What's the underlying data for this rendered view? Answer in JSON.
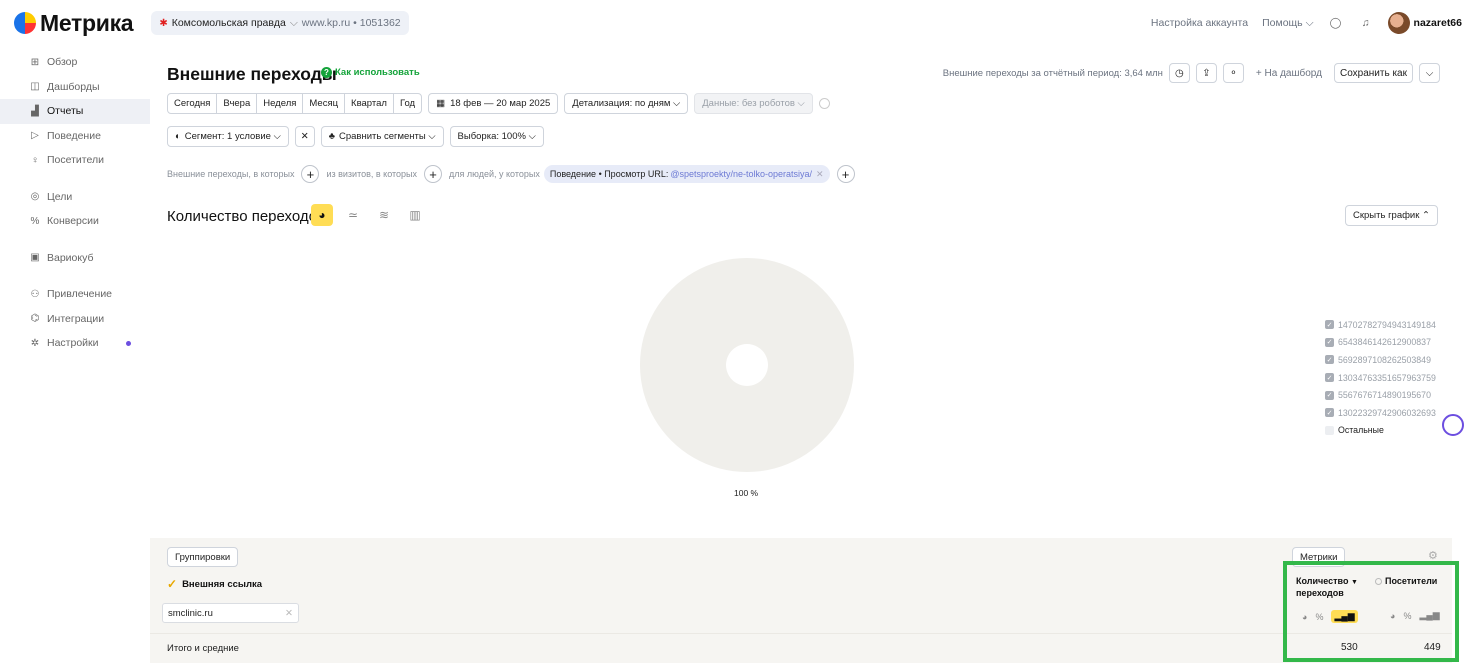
{
  "app": {
    "logo_text": "Метрика",
    "counter_name": "Комсомольская правда",
    "counter_site": "www.kp.ru",
    "counter_id": "1051362"
  },
  "topbar": {
    "account_settings": "Настройка аккаунта",
    "help": "Помощь",
    "user_name": "nazaret66"
  },
  "sidebar": {
    "items": [
      {
        "label": "Обзор",
        "icon": "grid-icon"
      },
      {
        "label": "Дашборды",
        "icon": "dashboard-icon"
      },
      {
        "label": "Отчеты",
        "icon": "reports-icon",
        "active": true
      },
      {
        "label": "Поведение",
        "icon": "play-icon"
      },
      {
        "label": "Посетители",
        "icon": "person-icon"
      },
      {
        "label": "Цели",
        "icon": "target-icon"
      },
      {
        "label": "Конверсии",
        "icon": "percent-icon"
      },
      {
        "label": "Вариокуб",
        "icon": "cube-icon"
      },
      {
        "label": "Привлечение",
        "icon": "users-icon"
      },
      {
        "label": "Интеграции",
        "icon": "integrations-icon"
      },
      {
        "label": "Настройки",
        "icon": "gear-icon"
      }
    ]
  },
  "header": {
    "title": "Внешние переходы",
    "how_to": "Как использовать",
    "period_total": "Внешние переходы за отчётный период: 3,64 млн",
    "to_dashboard": "+ На дашборд",
    "save_as": "Сохранить как"
  },
  "period": {
    "options": [
      "Сегодня",
      "Вчера",
      "Неделя",
      "Месяц",
      "Квартал",
      "Год"
    ],
    "date_range": "18 фев — 20 мар 2025",
    "detail": "Детализация: по дням",
    "data": "Данные: без роботов"
  },
  "segment": {
    "label": "Сегмент: 1 условие",
    "compare": "Сравнить сегменты",
    "sample": "Выборка: 100%"
  },
  "filters": {
    "text1": "Внешние переходы, в которых",
    "text2": "из визитов, в которых",
    "text3": "для людей, у которых",
    "condition_label": "Поведение • Просмотр URL:",
    "condition_value": "@spetsproekty/ne-tolko-operatsiya/"
  },
  "chart": {
    "title": "Количество переходов",
    "hide_button": "Скрыть график",
    "center_label": "100 %",
    "legend": [
      "14702782794943149184",
      "6543846142612900837",
      "5692897108262503849",
      "13034763351657963759",
      "5567676714890195670",
      "13022329742906032693",
      "Остальные"
    ],
    "donut_color": "#f0efeb"
  },
  "chart_data": {
    "type": "pie",
    "categories": [
      "smclinic.ru"
    ],
    "values": [
      100
    ],
    "title": "Количество переходов"
  },
  "table": {
    "groupings_btn": "Группировки",
    "metrics_btn": "Метрики",
    "dimension": "Внешняя ссылка",
    "filter_value": "smclinic.ru",
    "total_label": "Итого и средние",
    "metrics": [
      {
        "label_line1": "Количество",
        "label_line2": "переходов",
        "total": "530"
      },
      {
        "label_line1": "Посетители",
        "label_line2": "",
        "total": "449"
      }
    ]
  }
}
